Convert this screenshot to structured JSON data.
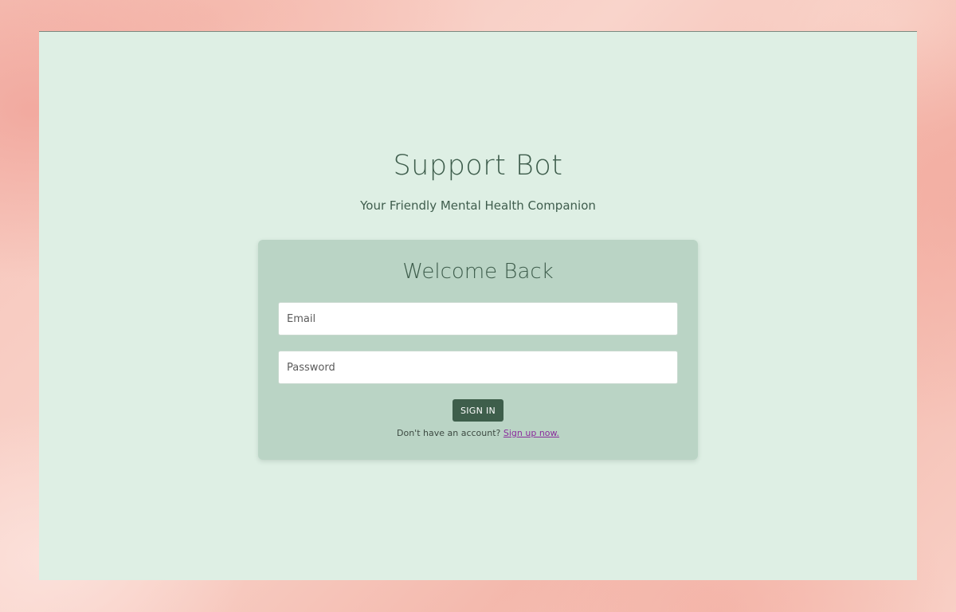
{
  "header": {
    "title": "Support Bot",
    "subtitle": "Your Friendly Mental Health Companion"
  },
  "login": {
    "heading": "Welcome Back",
    "email_placeholder": "Email",
    "password_placeholder": "Password",
    "submit_label": "SIGN IN",
    "signup_prompt": "Don't have an account?",
    "signup_link": "Sign up now."
  },
  "colors": {
    "page_background": "#deefe4",
    "card_background": "#bad4c5",
    "primary": "#3e5e4b",
    "link": "#8a2c9c"
  }
}
